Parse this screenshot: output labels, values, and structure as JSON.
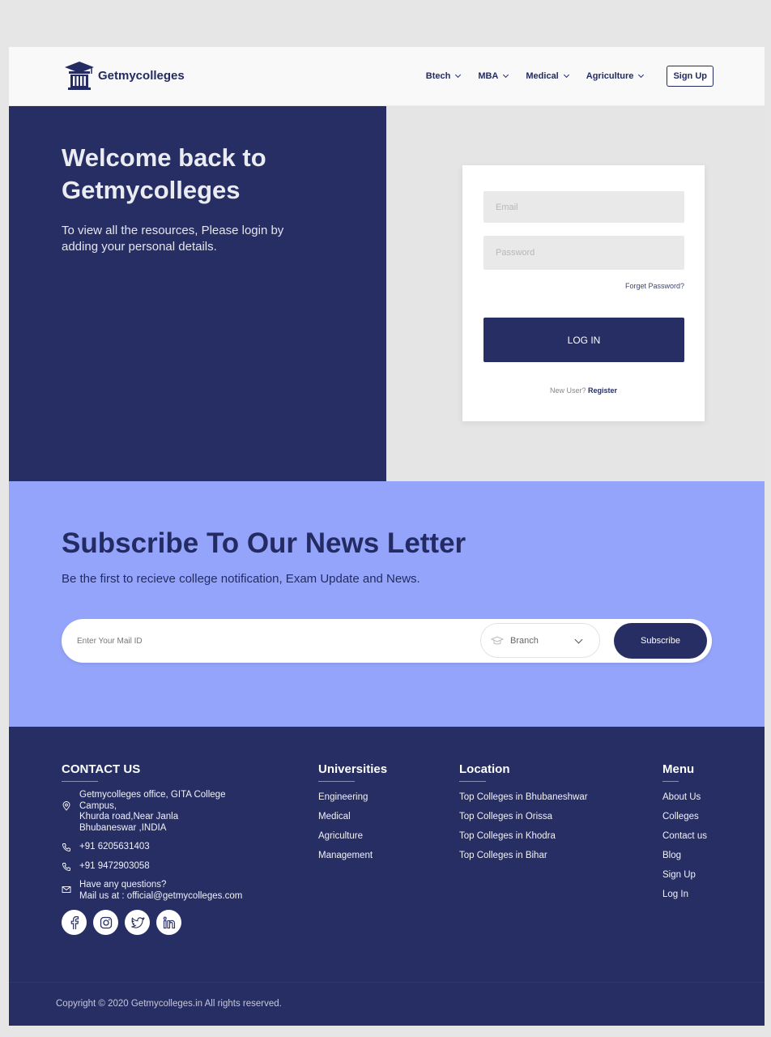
{
  "header": {
    "logo_text": "Getmycolleges",
    "nav": [
      {
        "label": "Btech"
      },
      {
        "label": "MBA"
      },
      {
        "label": "Medical"
      },
      {
        "label": "Agriculture"
      }
    ],
    "signup_label": "Sign Up"
  },
  "hero": {
    "title": "Welcome back to Getmycolleges",
    "subtitle": "To view all the resources, Please login by adding your personal details."
  },
  "login": {
    "email_placeholder": "Email",
    "password_placeholder": "Password",
    "forget_label": "Forget Password?",
    "login_label": "LOG IN",
    "new_user_label": "New User?",
    "register_label": "Register"
  },
  "newsletter": {
    "title": "Subscribe To Our News Letter",
    "subtitle": "Be the first to recieve college notification, Exam Update and News.",
    "mail_placeholder": "Enter Your Mail ID",
    "branch_label": "Branch",
    "subscribe_label": "Subscribe"
  },
  "footer": {
    "contact": {
      "heading": "CONTACT US",
      "address_line1": "Getmycolleges office, GITA College",
      "address_line2": "Campus,",
      "address_line3": "Khurda road,Near Janla",
      "address_line4": "Bhubaneswar ,INDIA",
      "phone1": "+91 6205631403",
      "phone2": "+91 9472903058",
      "mail_line1": "Have any questions?",
      "mail_line2": "Mail us at : official@getmycolleges.com"
    },
    "universities": {
      "heading": "Universities",
      "links": [
        "Engineering",
        "Medical",
        "Agriculture",
        "Management"
      ]
    },
    "location": {
      "heading": "Location",
      "links": [
        "Top Colleges in Bhubaneshwar",
        "Top Colleges in Orissa",
        "Top Colleges in Khodra",
        "Top Colleges in Bihar"
      ]
    },
    "menu": {
      "heading": "Menu",
      "links": [
        "About Us",
        "Colleges",
        "Contact us",
        "Blog",
        "Sign Up",
        "Log In"
      ]
    },
    "social": [
      "facebook-icon",
      "instagram-icon",
      "twitter-icon",
      "linkedin-icon"
    ],
    "copyright": "Copyright © 2020 Getmycolleges.in All rights reserved."
  },
  "colors": {
    "navy": "#262e63",
    "periwinkle": "#95a4fb",
    "light_gray": "#e5e5e5"
  }
}
